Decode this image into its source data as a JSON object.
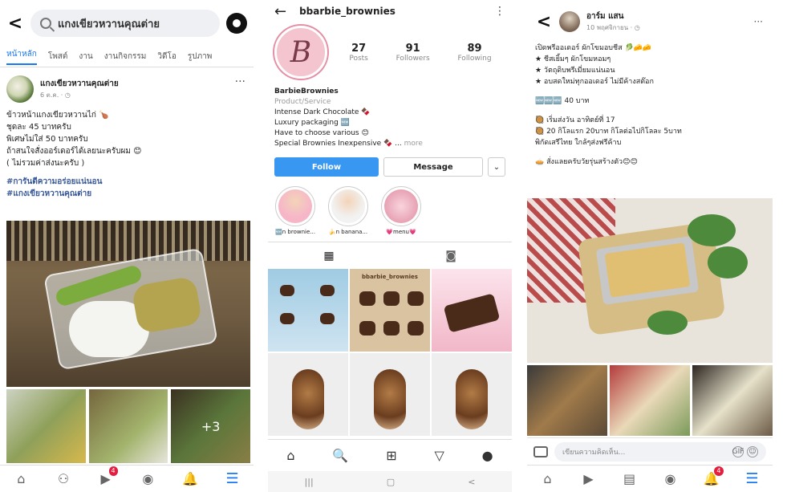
{
  "panel1": {
    "search_text": "แกงเขียวหวานคุณต่าย",
    "tabs": [
      "หน้าหลัก",
      "โพสต์",
      "งาน",
      "งานกิจกรรม",
      "วิดีโอ",
      "รูปภาพ"
    ],
    "post": {
      "name": "แกงเขียวหวานคุณต่าย",
      "time": "6 ต.ค. · ◷",
      "lines": [
        "ข้าวหน้าแกงเขียวหวานไก่ 🍗",
        "ชุดละ 45 บาทครับ",
        "พิเศษไม่ใส่ 50 บาทครับ",
        "ถ้าสนใจสั่งออร์เดอร์ได้เลยนะครับผม 😊",
        "( ไม่รวมค่าส่งนะครับ )"
      ],
      "tags": [
        "#การันตีความอร่อยแน่นอน",
        "#แกงเขียวหวานคุณต่าย"
      ]
    },
    "more_count": "+3",
    "nav_badge": "4"
  },
  "panel2": {
    "username": "bbarbie_brownies",
    "logo_letter": "B",
    "stats": [
      {
        "num": "27",
        "label": "Posts"
      },
      {
        "num": "91",
        "label": "Followers"
      },
      {
        "num": "89",
        "label": "Following"
      }
    ],
    "bio": {
      "name": "BarbieBrownies",
      "category": "Product/Service",
      "lines": [
        "Intense Dark Chocolate 🍫",
        "Luxury packaging 🆕",
        "Have to choose various 😊"
      ],
      "last_line": "Special Brownies Inexpensive 🍫 ...",
      "more": "more"
    },
    "follow_label": "Follow",
    "message_label": "Message",
    "dropdown_label": "⌄",
    "highlights": [
      "🆕n brownie...",
      "🍌n banana...",
      "💗menu💗"
    ],
    "grid_title": "bbarbie_brownies"
  },
  "panel3": {
    "name": "อาร์ม แสน",
    "time": "10 พฤศจิกายน · ◷",
    "lines_a": [
      "เปิดพรีออเดอร์ ผักโขมอบชีส 🥬🧀🧀",
      "★ ชีสเยิ้มๆ ผักโขมหอมๆ",
      "★ วัตถุดิบพรีเมี่ยมแน่นอน",
      "★ อบสดใหม่ทุกออเดอร์ ไม่มีค้างสต๊อก"
    ],
    "price": "🆕🆕🆕 40 บาท",
    "lines_b": [
      "🥘 เริ่มส่งวัน อาทิตย์ที่ 17",
      "🥘 20 กิโลแรก 20บาท กิโลต่อไปกิโลละ 5บาท",
      "พิกัดเสรีไทย ใกล้ๆส่งฟรีค้าบ"
    ],
    "closing": "🥧 สั่งแลยครับวัยรุ่นสร้างตัว😊😊",
    "comment_placeholder": "เขียนความคิดเห็น...",
    "comment_gif": "GIF",
    "nav_badge": "4"
  },
  "colors": {
    "fb_blue": "#1877f2",
    "ig_blue": "#3897f0",
    "badge_red": "#e41e3f"
  }
}
